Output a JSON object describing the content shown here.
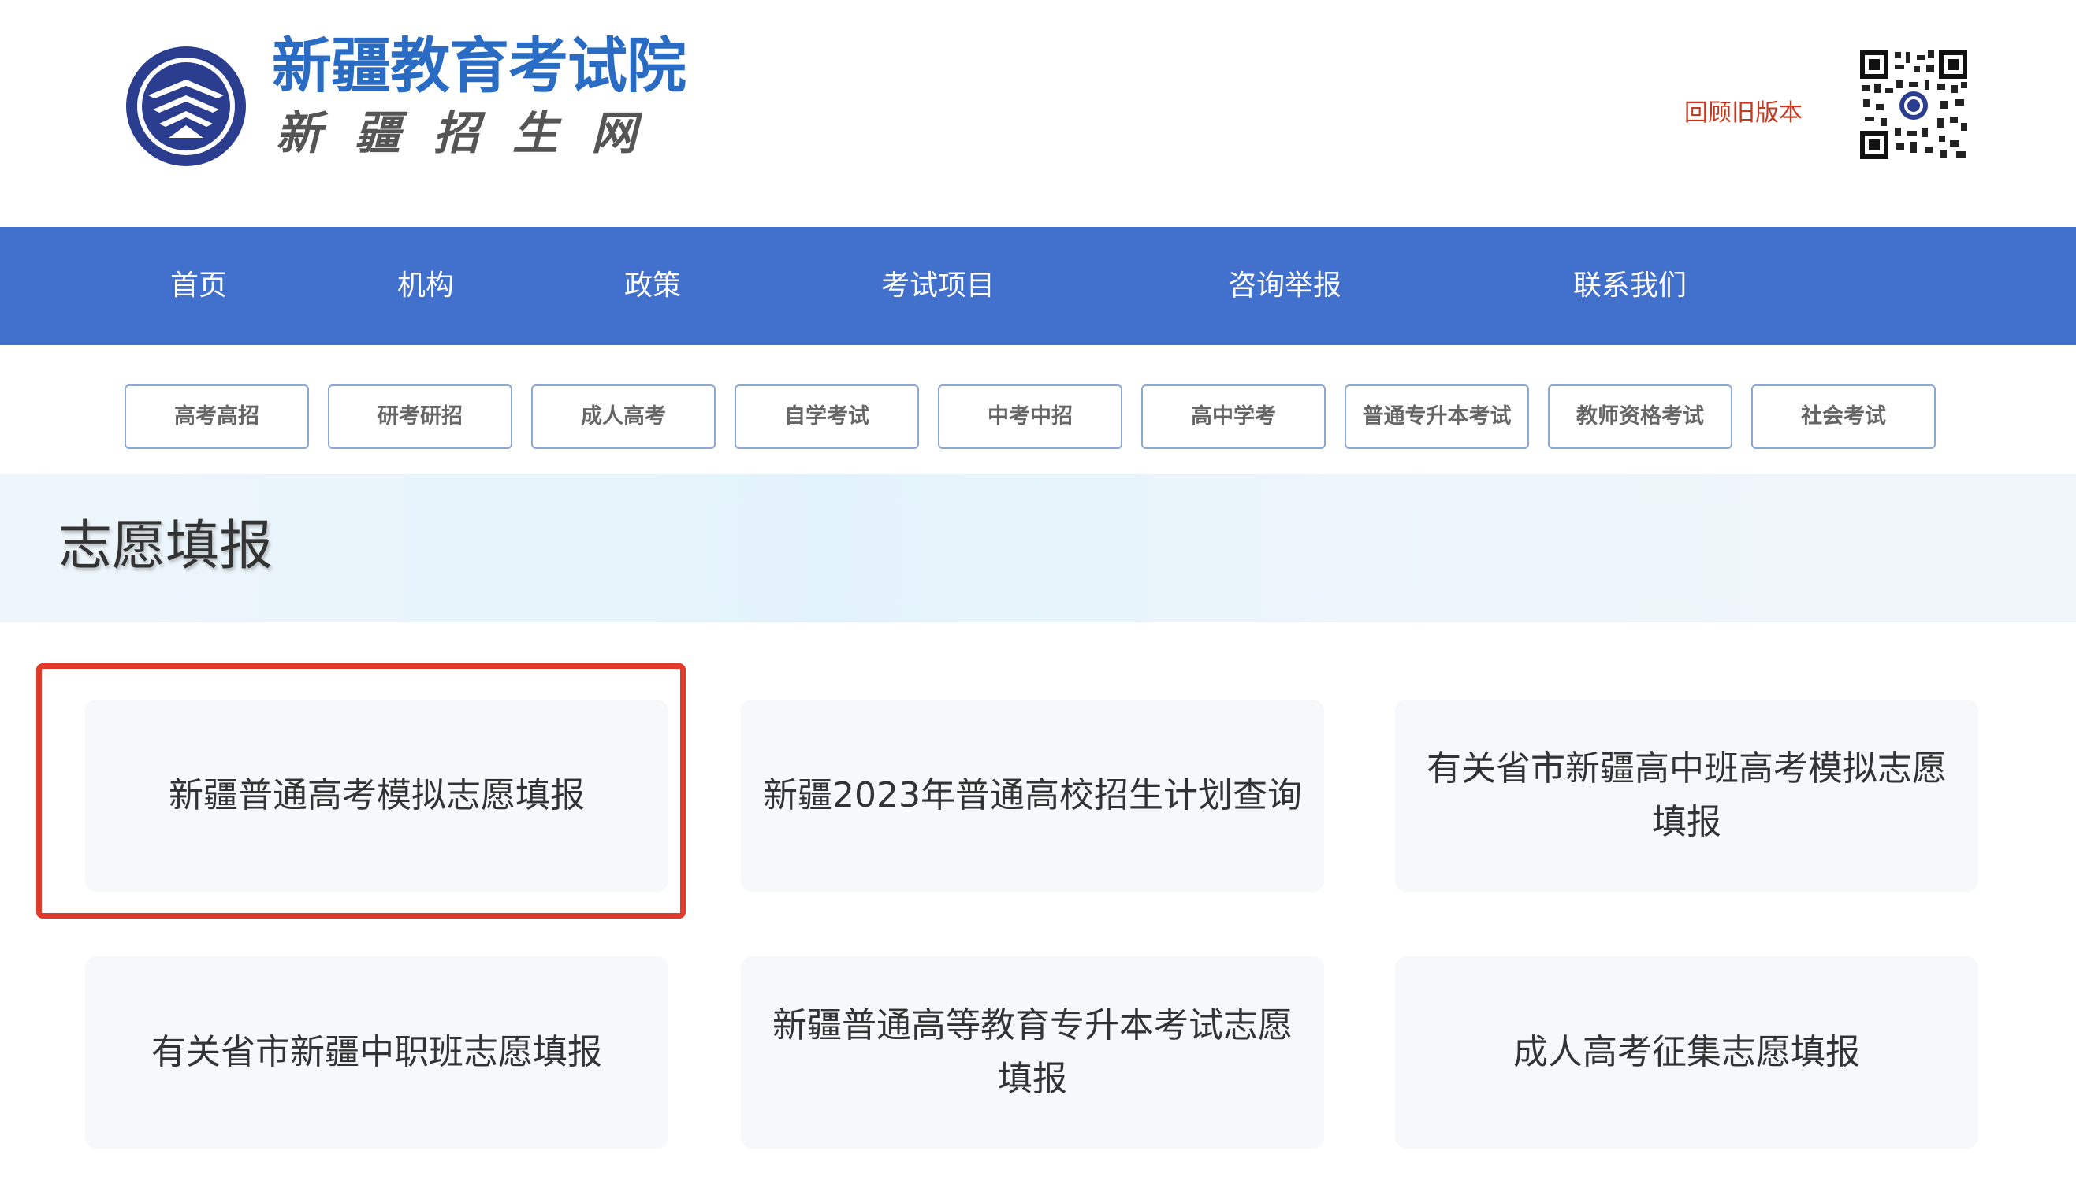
{
  "header": {
    "title": "新疆教育考试院",
    "subtitle": "新疆招生网",
    "old_version_link": "回顾旧版本",
    "logo_icon": "exam-authority-emblem-icon",
    "qr_icon": "qr-code-icon",
    "brand_color": "#2a6cc4",
    "link_color": "#c43a20"
  },
  "nav": {
    "background": "#4170cd",
    "items": [
      {
        "label": "首页"
      },
      {
        "label": "机构"
      },
      {
        "label": "政策"
      },
      {
        "label": "考试项目"
      },
      {
        "label": "咨询举报"
      },
      {
        "label": "联系我们"
      }
    ]
  },
  "subnav": {
    "tabs": [
      {
        "label": "高考高招"
      },
      {
        "label": "研考研招"
      },
      {
        "label": "成人高考"
      },
      {
        "label": "自学考试"
      },
      {
        "label": "中考中招"
      },
      {
        "label": "高中学考"
      },
      {
        "label": "普通专升本考试"
      },
      {
        "label": "教师资格考试"
      },
      {
        "label": "社会考试"
      }
    ]
  },
  "banner": {
    "title": "志愿填报"
  },
  "cards": [
    {
      "label": "新疆普通高考模拟志愿填报",
      "highlighted": true
    },
    {
      "label": "新疆2023年普通高校招生计划查询"
    },
    {
      "label": "有关省市新疆高中班高考模拟志愿填报"
    },
    {
      "label": "有关省市新疆中职班志愿填报"
    },
    {
      "label": "新疆普通高等教育专升本考试志愿填报"
    },
    {
      "label": "成人高考征集志愿填报"
    }
  ],
  "highlight_color": "#e23a2a"
}
